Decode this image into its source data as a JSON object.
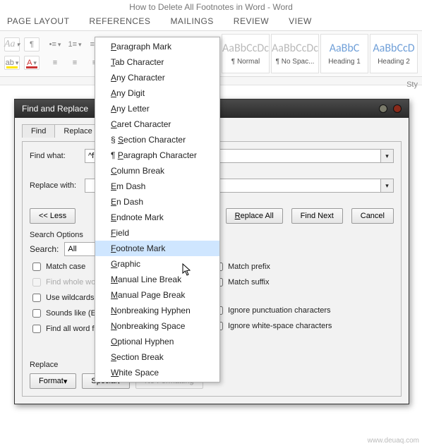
{
  "title": "How to Delete All Footnotes in Word - Word",
  "menus": {
    "page_layout": "PAGE LAYOUT",
    "references": "REFERENCES",
    "mailings": "MAILINGS",
    "review": "REVIEW",
    "view": "VIEW"
  },
  "styles": [
    {
      "preview": "AaBbCcDc",
      "name": "¶ Normal"
    },
    {
      "preview": "AaBbCcDc",
      "name": "¶ No Spac..."
    },
    {
      "preview": "AaBbC",
      "name": "Heading 1"
    },
    {
      "preview": "AaBbCcD",
      "name": "Heading 2"
    }
  ],
  "styles_hint": "Sty",
  "dialog": {
    "title": "Find and Replace",
    "tabs": {
      "find": "Find",
      "replace": "Replace"
    },
    "labels": {
      "find_what": "Find what:",
      "replace_with": "Replace with:",
      "search_options": "Search Options",
      "search": "Search:",
      "replace_section": "Replace"
    },
    "values": {
      "find_input": "^f",
      "replace_input": "",
      "search_scope": "All"
    },
    "buttons": {
      "less": "<<  Less",
      "replace_all": "Replace All",
      "find_next": "Find Next",
      "cancel": "Cancel",
      "format": "Format",
      "special": "Special",
      "no_formatting": "No Formatting"
    },
    "checks": {
      "match_case": "Match case",
      "whole_word": "Find whole words only",
      "wildcards": "Use wildcards",
      "sounds_like": "Sounds like (English)",
      "find_all_wordforms": "Find all word forms (English)",
      "match_prefix": "Match prefix",
      "match_suffix": "Match suffix",
      "ignore_punct": "Ignore punctuation characters",
      "ignore_ws": "Ignore white-space characters"
    }
  },
  "special_menu": [
    "Paragraph Mark",
    "Tab Character",
    "Any Character",
    "Any Digit",
    "Any Letter",
    "Caret Character",
    "§ Section Character",
    "¶ Paragraph Character",
    "Column Break",
    "Em Dash",
    "En Dash",
    "Endnote Mark",
    "Field",
    "Footnote Mark",
    "Graphic",
    "Manual Line Break",
    "Manual Page Break",
    "Nonbreaking Hyphen",
    "Nonbreaking Space",
    "Optional Hyphen",
    "Section Break",
    "White Space"
  ],
  "hovered_item": "Footnote Mark",
  "watermark": "www.deuaq.com"
}
